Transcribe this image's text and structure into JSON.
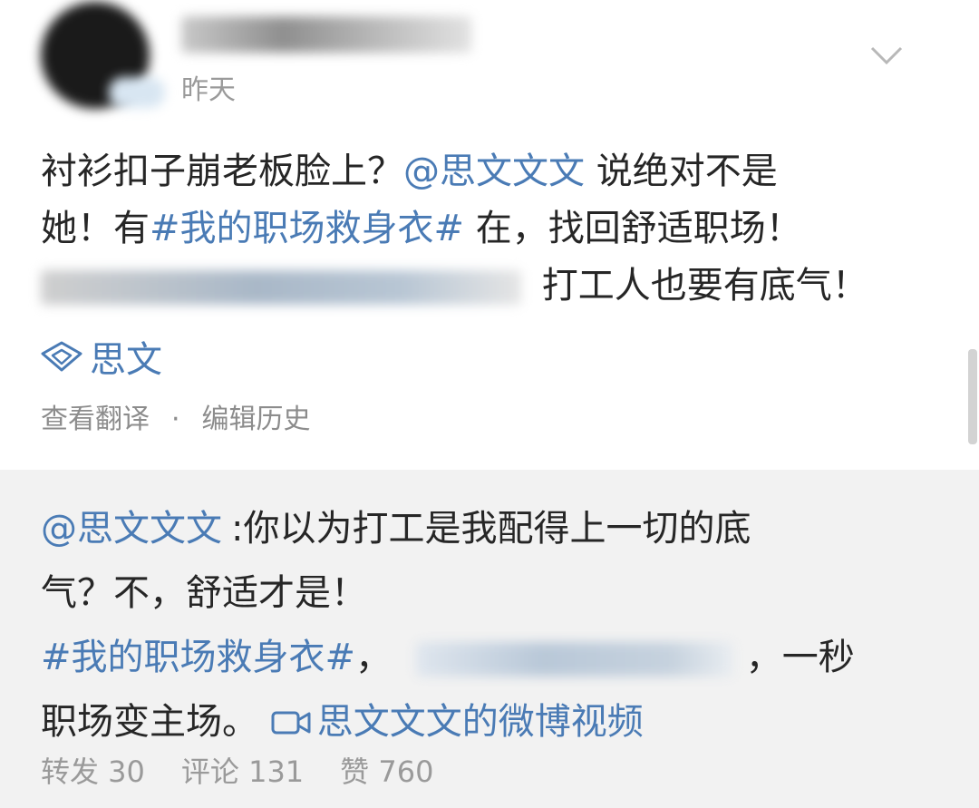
{
  "post": {
    "time": "昨天",
    "line1": {
      "pre": "衬衫扣子崩老板脸上？",
      "mention": "@思文文文",
      "post": " 说绝对不是"
    },
    "line2": {
      "pre": "她！有",
      "hashtag": "#我的职场救身衣#",
      "post": " 在，找回舒适职场！"
    },
    "line3": {
      "post": "打工人也要有底气！"
    },
    "source": "思文",
    "actions": {
      "translate": "查看翻译",
      "separator": "·",
      "edit_history": "编辑历史"
    }
  },
  "repost": {
    "line1": {
      "mention": "@思文文文",
      "text": ":你以为打工是我配得上一切的底"
    },
    "line2": "气？不，舒适才是！",
    "line3": {
      "hashtag": "#我的职场救身衣#",
      "comma": "，",
      "post": "，一秒"
    },
    "line4": {
      "pre": "职场变主场。",
      "video_link": "思文文文的微博视频"
    },
    "stats": {
      "repost": "转发 30",
      "comment": "评论 131",
      "like": "赞 760"
    }
  },
  "colors": {
    "link": "#4a7bb5",
    "repost_bg": "#f2f2f2",
    "meta": "#9a9a9a"
  },
  "icons": [
    "chevron-down-icon",
    "diamond-icon",
    "video-icon"
  ]
}
